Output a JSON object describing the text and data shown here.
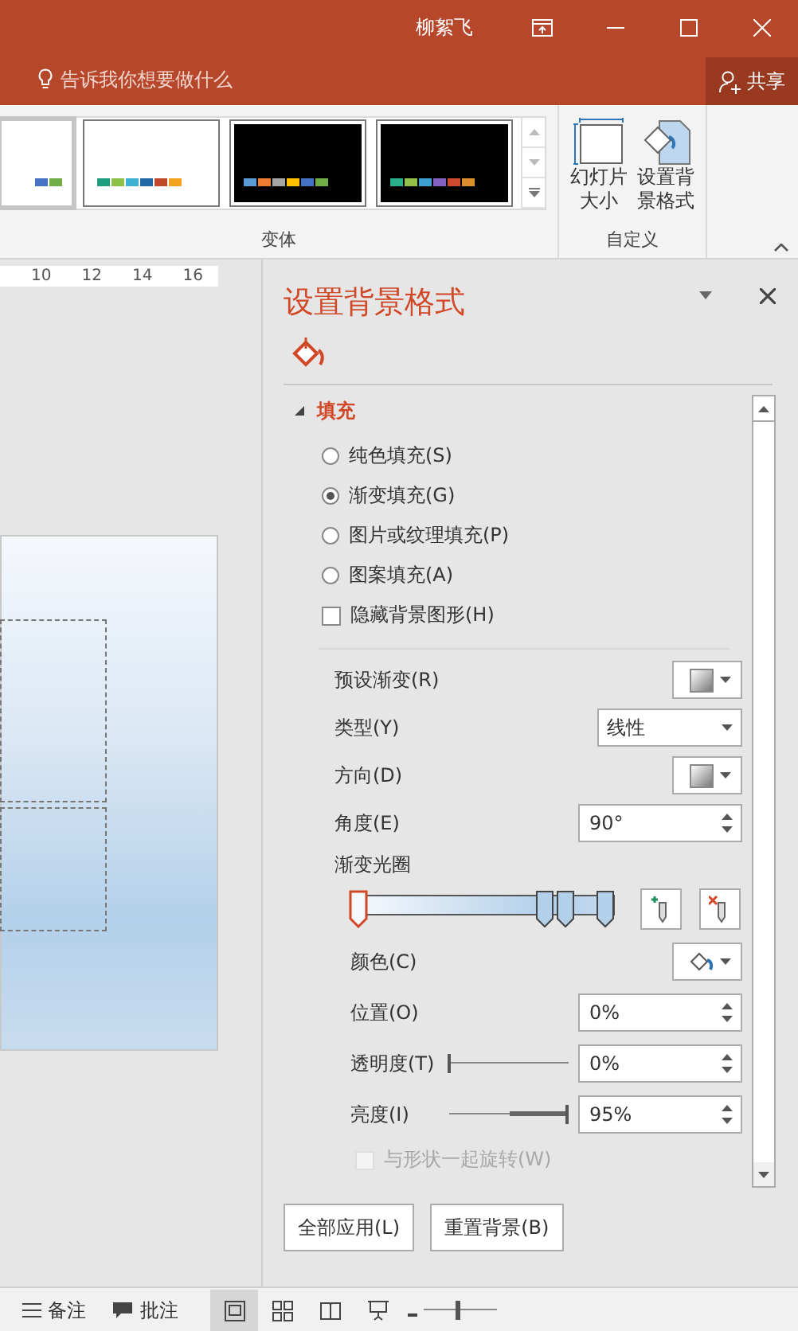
{
  "window": {
    "user": "柳絮飞"
  },
  "tell_me": {
    "placeholder": "告诉我你想要做什么"
  },
  "share_button": {
    "label": "共享"
  },
  "ribbon": {
    "variants": [
      {
        "kind": "light",
        "selected": true,
        "swatches": [
          {
            "color": "#4472c4"
          },
          {
            "color": "#70ad47"
          }
        ]
      },
      {
        "kind": "light",
        "selected": false,
        "swatches": [
          {
            "color": "#1f9e7e"
          },
          {
            "color": "#8dc04b"
          },
          {
            "color": "#3cb1d0"
          },
          {
            "color": "#2068a6"
          },
          {
            "color": "#c0492a"
          },
          {
            "color": "#f2a21c"
          }
        ]
      },
      {
        "kind": "dark",
        "selected": false,
        "swatches": [
          {
            "color": "#5b9bd5"
          },
          {
            "color": "#ed7d31"
          },
          {
            "color": "#a5a5a5"
          },
          {
            "color": "#ffc000"
          },
          {
            "color": "#4472c4"
          },
          {
            "color": "#70ad47"
          }
        ]
      },
      {
        "kind": "dark",
        "selected": false,
        "swatches": [
          {
            "color": "#2bae8a"
          },
          {
            "color": "#93c048"
          },
          {
            "color": "#3c9ed1"
          },
          {
            "color": "#8460c2"
          },
          {
            "color": "#cd4a2e"
          },
          {
            "color": "#dd8f2e"
          }
        ]
      }
    ],
    "variants_group": "变体",
    "custom_buttons": [
      {
        "kind": "slide-size",
        "lines": [
          "幻灯片",
          "大小"
        ]
      },
      {
        "kind": "format-background",
        "lines": [
          "设置背",
          "景格式"
        ]
      }
    ],
    "custom_group": "自定义"
  },
  "ruler": {
    "labels": [
      "10",
      "12",
      "14",
      "16"
    ]
  },
  "pane": {
    "title": "设置背景格式",
    "fill_section": {
      "label": "填充",
      "expanded": true
    },
    "fill_options": [
      {
        "label": "纯色填充(S)",
        "selected": false
      },
      {
        "label": "渐变填充(G)",
        "selected": true
      },
      {
        "label": "图片或纹理填充(P)",
        "selected": false
      },
      {
        "label": "图案填充(A)",
        "selected": false
      }
    ],
    "hide_graphics": {
      "label": "隐藏背景图形(H)",
      "checked": false
    },
    "gradient_settings": [
      {
        "kind": "swatch-dropdown",
        "label": "预设渐变(R)"
      },
      {
        "kind": "dropdown",
        "label": "类型(Y)",
        "value": "线性"
      },
      {
        "kind": "swatch-dropdown",
        "label": "方向(D)"
      },
      {
        "kind": "spinner",
        "label": "角度(E)",
        "value": "90°"
      }
    ],
    "gradient_stops": {
      "label": "渐变光圈",
      "stops": [
        {
          "level": 0,
          "selected": true
        },
        {
          "level": 0.73,
          "selected": false
        },
        {
          "level": 0.81,
          "selected": false
        },
        {
          "level": 0.97,
          "selected": false
        }
      ]
    },
    "stop_settings": [
      {
        "kind": "color-dropdown",
        "label": "颜色(C)"
      },
      {
        "kind": "spinner",
        "label": "位置(O)",
        "value": "0%"
      },
      {
        "kind": "slider-spinner",
        "label": "透明度(T)",
        "level": 0,
        "value": "0%"
      },
      {
        "kind": "slider-spinner",
        "label": "亮度(I)",
        "level": 0.98,
        "value": "95%"
      }
    ],
    "rotate_with_shape": {
      "label": "与形状一起旋转(W)",
      "checked": false,
      "disabled": true
    },
    "buttons": [
      "全部应用(L)",
      "重置背景(B)"
    ]
  },
  "status_bar": {
    "notes": "备注",
    "comments": "批注",
    "zoom_slider": {
      "level": 0.45
    }
  }
}
